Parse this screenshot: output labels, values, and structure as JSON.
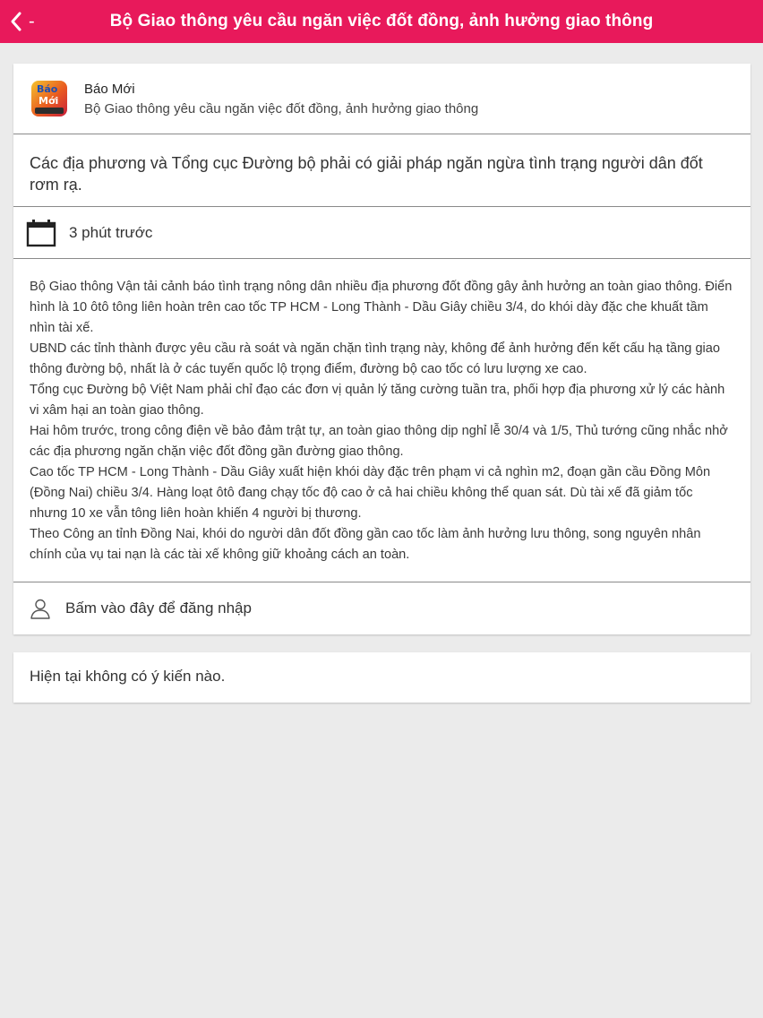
{
  "header": {
    "title": "Bộ Giao thông yêu cầu ngăn việc đốt đồng, ảnh hưởng giao thông",
    "back_icon": "chevron-left-icon",
    "back_suffix": "-",
    "bg_color": "#e8195b"
  },
  "source": {
    "logo_icon": "bao-moi-logo",
    "logo_line1": "Báo",
    "logo_line2": "Mới",
    "name": "Báo Mới",
    "headline": "Bộ Giao thông yêu cầu ngăn việc đốt đồng, ảnh hưởng giao thông"
  },
  "summary": "Các địa phương và Tổng cục Đường bộ phải có giải pháp ngăn ngừa tình trạng người dân đốt rơm rạ.",
  "time": {
    "icon": "calendar-icon",
    "text": "3 phút trước"
  },
  "paragraphs": [
    "Bộ Giao thông Vận tải cảnh báo tình trạng nông dân nhiều địa phương đốt đồng gây ảnh hưởng an toàn giao thông. Điển hình là 10 ôtô tông liên hoàn trên cao tốc TP HCM - Long Thành - Dầu Giây chiều 3/4, do khói dày đặc che khuất tầm nhìn tài xế.",
    "UBND các tỉnh thành được yêu cầu rà soát và ngăn chặn tình trạng này, không để ảnh hưởng đến kết cấu hạ tầng giao thông đường bộ, nhất là ở các tuyến quốc lộ trọng điểm, đường bộ cao tốc có lưu lượng xe cao.",
    "Tổng cục Đường bộ Việt Nam phải chỉ đạo các đơn vị quản lý tăng cường tuần tra, phối hợp địa phương xử lý các hành vi xâm hại an toàn giao thông.",
    "Hai hôm trước, trong công điện về bảo đảm trật tự, an toàn giao thông dịp nghỉ lễ 30/4 và 1/5, Thủ tướng cũng nhắc nhở các địa phương ngăn chặn việc đốt đồng gần đường giao thông.",
    "Cao tốc TP HCM - Long Thành - Dầu Giây xuất hiện khói dày đặc trên phạm vi cả nghìn m2, đoạn gần cầu Đồng Môn (Đồng Nai) chiều 3/4. Hàng loạt ôtô đang chạy tốc độ cao ở cả hai chiều không thể quan sát. Dù tài xế đã giảm tốc nhưng 10 xe vẫn tông liên hoàn khiến 4 người bị thương.",
    "Theo Công an tỉnh Đồng Nai, khói do người dân đốt đồng gần cao tốc làm ảnh hưởng lưu thông, song nguyên nhân chính của vụ tai nạn là các tài xế không giữ khoảng cách an toàn."
  ],
  "login": {
    "icon": "user-icon",
    "text": "Bấm vào đây để đăng nhập"
  },
  "comments": {
    "empty_text": "Hiện tại không có ý kiến nào."
  }
}
